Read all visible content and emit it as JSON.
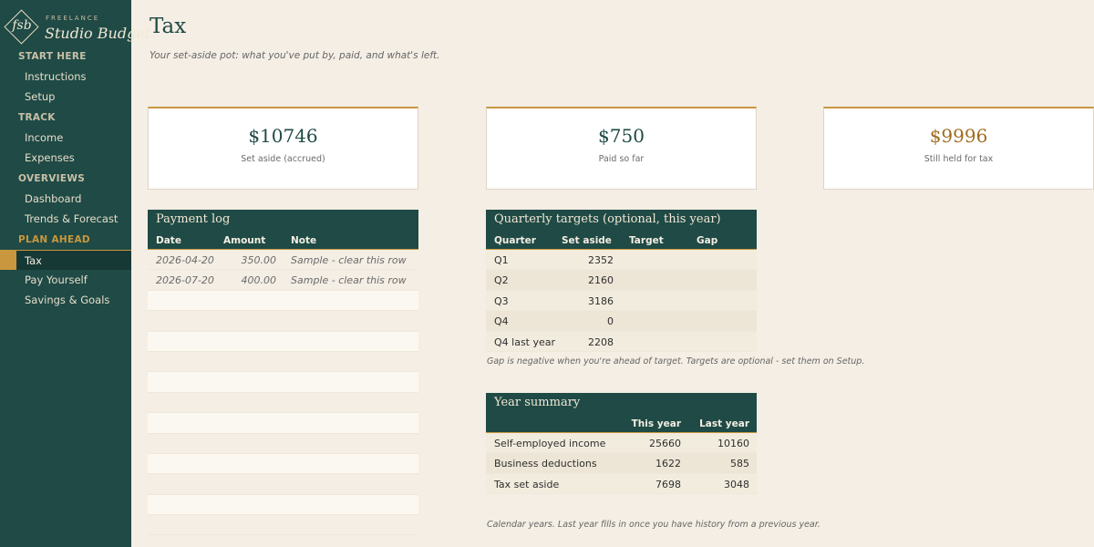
{
  "brand": {
    "mark": "fsb",
    "small": "FREELANCE",
    "name": "Studio Budget"
  },
  "nav": {
    "start_here": "START HERE",
    "instructions": "Instructions",
    "setup": "Setup",
    "track": "TRACK",
    "income": "Income",
    "expenses": "Expenses",
    "overviews": "OVERVIEWS",
    "dashboard": "Dashboard",
    "trends": "Trends & Forecast",
    "plan_ahead": "PLAN AHEAD",
    "tax": "Tax",
    "pay_yourself": "Pay Yourself",
    "savings": "Savings & Goals"
  },
  "page": {
    "title": "Tax",
    "subtitle": "Your set-aside pot: what you've put by, paid, and what's left."
  },
  "cards": [
    {
      "value": "$10746",
      "label": "Set aside (accrued)"
    },
    {
      "value": "$750",
      "label": "Paid so far"
    },
    {
      "value": "$9996",
      "label": "Still held for tax"
    }
  ],
  "payment_log": {
    "title": "Payment log",
    "columns": [
      "Date",
      "Amount",
      "Note"
    ],
    "rows": [
      {
        "date": "2026-04-20",
        "amount": "350.00",
        "note": "Sample - clear this row"
      },
      {
        "date": "2026-07-20",
        "amount": "400.00",
        "note": "Sample - clear this row"
      }
    ]
  },
  "quarterly": {
    "title": "Quarterly targets (optional, this year)",
    "columns": [
      "Quarter",
      "Set aside",
      "Target",
      "Gap"
    ],
    "rows": [
      {
        "quarter": "Q1",
        "set_aside": "2352"
      },
      {
        "quarter": "Q2",
        "set_aside": "2160"
      },
      {
        "quarter": "Q3",
        "set_aside": "3186"
      },
      {
        "quarter": "Q4",
        "set_aside": "0"
      },
      {
        "quarter": "Q4 last year",
        "set_aside": "2208"
      }
    ],
    "note": "Gap is negative when you're ahead of target. Targets are optional - set them on Setup."
  },
  "year_summary": {
    "title": "Year summary",
    "columns": [
      "This year",
      "Last year"
    ],
    "rows": [
      {
        "label": "Self-employed income",
        "this_year": "25660",
        "last_year": "10160"
      },
      {
        "label": "Business deductions",
        "this_year": "1622",
        "last_year": "585"
      },
      {
        "label": "Tax set aside",
        "this_year": "7698",
        "last_year": "3048"
      }
    ],
    "note": "Calendar years. Last year fills in once you have history from a previous year."
  },
  "colors": {
    "sidebar": "#1f4a45",
    "accent": "#c8973e",
    "background": "#f4eee4"
  }
}
